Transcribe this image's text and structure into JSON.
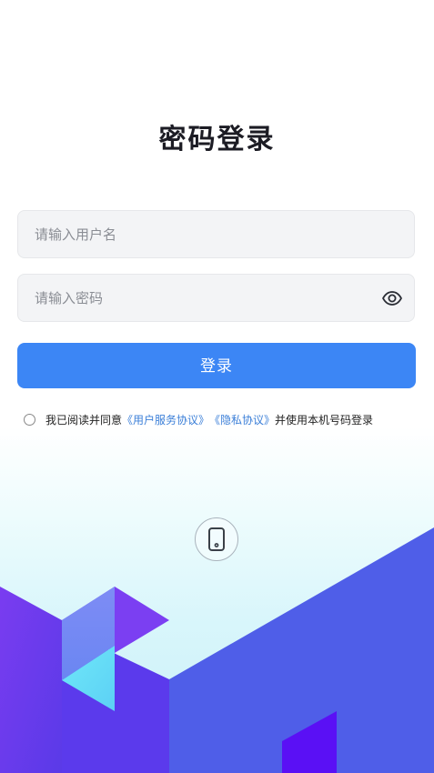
{
  "page": {
    "title": "密码登录"
  },
  "form": {
    "username_placeholder": "请输入用户名",
    "password_placeholder": "请输入密码",
    "login_label": "登录"
  },
  "agreement": {
    "prefix": "我已阅读并同意",
    "service_link": "《用户服务协议》",
    "privacy_link": "《隐私协议》",
    "suffix": "并使用本机号码登录",
    "checked": false
  },
  "icons": {
    "password_toggle": "eye-icon",
    "alt_login": "mobile-phone-icon"
  },
  "colors": {
    "primary": "#3c86f5",
    "link": "#3b7fd8",
    "input_bg": "#f3f4f6",
    "art_blue": "#4f5ee8",
    "art_purple": "#6a3af0"
  }
}
